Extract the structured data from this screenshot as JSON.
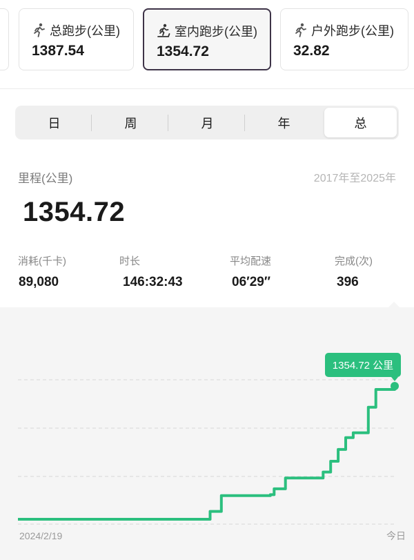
{
  "cards": {
    "total": {
      "title": "总跑步(公里)",
      "value": "1387.54",
      "icon": "running-icon"
    },
    "indoor": {
      "title": "室内跑步(公里)",
      "value": "1354.72",
      "icon": "treadmill-icon",
      "selected": true
    },
    "outdoor": {
      "title": "户外跑步(公里)",
      "value": "32.82",
      "icon": "running-icon"
    }
  },
  "tabs": [
    "日",
    "周",
    "月",
    "年",
    "总"
  ],
  "active_tab": "总",
  "summary": {
    "label": "里程(公里)",
    "range": "2017年至2025年",
    "total": "1354.72"
  },
  "stats": [
    {
      "label": "消耗(千卡)",
      "value": "89,080"
    },
    {
      "label": "时长",
      "value": "146:32:43"
    },
    {
      "label": "平均配速",
      "value": "06′29″"
    },
    {
      "label": "完成(次)",
      "value": "396"
    }
  ],
  "colors": {
    "accent": "#2bbf7e",
    "selected_border": "#3d3347"
  },
  "chart_data": {
    "type": "line",
    "x_start_label": "2024/2/19",
    "x_end_label": "今日",
    "tooltip": "1354.72 公里",
    "ylim": [
      0,
      1500
    ],
    "grid": true,
    "series": [
      {
        "x": [
          0,
          0.5,
          0.51,
          0.53,
          0.54,
          0.67,
          0.68,
          0.7,
          0.71,
          0.8,
          0.81,
          0.82,
          0.83,
          0.84,
          0.85,
          0.86,
          0.87,
          0.88,
          0.89,
          0.92,
          0.93,
          0.94,
          0.95,
          0.98,
          1.0
        ],
        "values": [
          0,
          0,
          80,
          80,
          240,
          250,
          310,
          310,
          420,
          420,
          480,
          480,
          590,
          590,
          710,
          710,
          830,
          830,
          880,
          880,
          1140,
          1140,
          1320,
          1320,
          1354.72
        ]
      }
    ]
  }
}
